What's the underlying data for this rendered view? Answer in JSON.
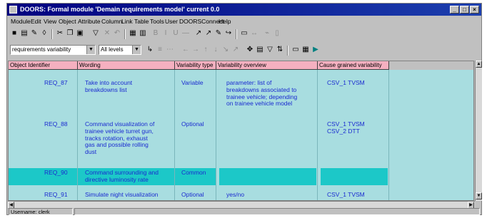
{
  "window": {
    "title": "DOORS: Formal module 'Demain requirements model' current 0.0"
  },
  "menu": [
    "Module",
    "Edit",
    "View",
    "Object",
    "Attribute",
    "Column",
    "Link",
    "Table",
    "Tools",
    "User",
    "DOORSConnect",
    "Help"
  ],
  "toolbar2": {
    "view_select": "requirements variability",
    "level_select": "All levels"
  },
  "columns": [
    "Object Identifier",
    "Wording",
    "Variability type",
    "Variability overview",
    "Cause grained variability"
  ],
  "rows": [
    {
      "id": "REQ_87",
      "wording": [
        "Take into account",
        "breakdowns list"
      ],
      "type": "Variable",
      "overview": [
        "parameter: list of",
        "breakdowns associated to",
        "trainee vehicle; depending",
        "on trainee vehicle model"
      ],
      "cause": [
        "CSV_1 TVSM"
      ]
    },
    {
      "id": "REQ_88",
      "wording": [
        "Command visualization of",
        "trainee vehicle turret gun,",
        "tracks rotation, exhaust",
        "gas and possible rolling",
        "dust"
      ],
      "type": "Optional",
      "overview": [],
      "cause": [
        "CSV_1 TVSM",
        "CSV_2 DTT"
      ]
    },
    {
      "id": "REQ_90",
      "wording": [
        "Command surrounding and",
        "directive luminosity rate"
      ],
      "type": "Common",
      "overview": [],
      "cause": []
    },
    {
      "id": "REQ_91",
      "wording": [
        "Simulate night visualization"
      ],
      "type": "Optional",
      "overview": [
        "yes/no"
      ],
      "cause": [
        "CSV_1 TVSM"
      ]
    }
  ],
  "status": {
    "user": "Username: clerk"
  },
  "colors": {
    "title_bar": "#00007f",
    "header_bg": "#f5b0c0",
    "grid_bg": "#a8dde0",
    "highlight": "#1cc8c8",
    "text": "#1a2ad0"
  }
}
